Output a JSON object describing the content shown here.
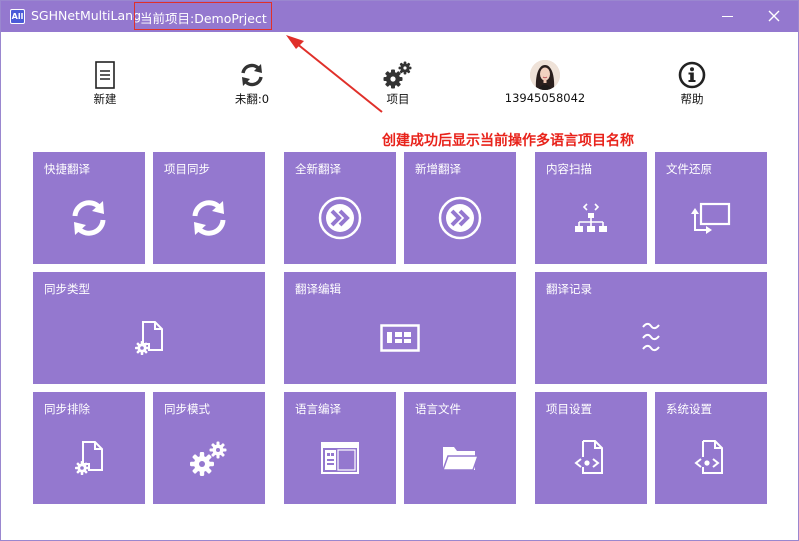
{
  "titlebar": {
    "app_icon_text": "All",
    "app_title": "SGHNetMultiLang",
    "project_title": "当前项目:DemoPrject"
  },
  "toolbar": {
    "new_label": "新建",
    "untranslated_label": "未翻:0",
    "project_label": "项目",
    "user_label": "13945058042",
    "help_label": "帮助"
  },
  "annotation": {
    "text": "创建成功后显示当前操作多语言项目名称",
    "color": "#e8231b"
  },
  "tiles": [
    {
      "label": "快捷翻译",
      "icon": "sync-icon"
    },
    {
      "label": "项目同步",
      "icon": "sync-icon"
    },
    {
      "label": "全新翻译",
      "icon": "forward-circle-icon"
    },
    {
      "label": "新增翻译",
      "icon": "forward-circle-icon"
    },
    {
      "label": "内容扫描",
      "icon": "hierarchy-icon"
    },
    {
      "label": "文件还原",
      "icon": "restore-window-icon"
    },
    {
      "label": "同步类型",
      "icon": "file-gear-icon"
    },
    {
      "label": "翻译编辑",
      "icon": "grid-window-icon"
    },
    {
      "label": "翻译记录",
      "icon": "wave-icon"
    },
    {
      "label": "同步排除",
      "icon": "file-gear-icon"
    },
    {
      "label": "同步模式",
      "icon": "gears-icon"
    },
    {
      "label": "语言编译",
      "icon": "app-window-icon"
    },
    {
      "label": "语言文件",
      "icon": "folder-icon"
    },
    {
      "label": "项目设置",
      "icon": "file-code-icon"
    },
    {
      "label": "系统设置",
      "icon": "file-code-icon"
    }
  ],
  "colors": {
    "accent": "#9478cf",
    "highlight_border": "#e0302a"
  }
}
